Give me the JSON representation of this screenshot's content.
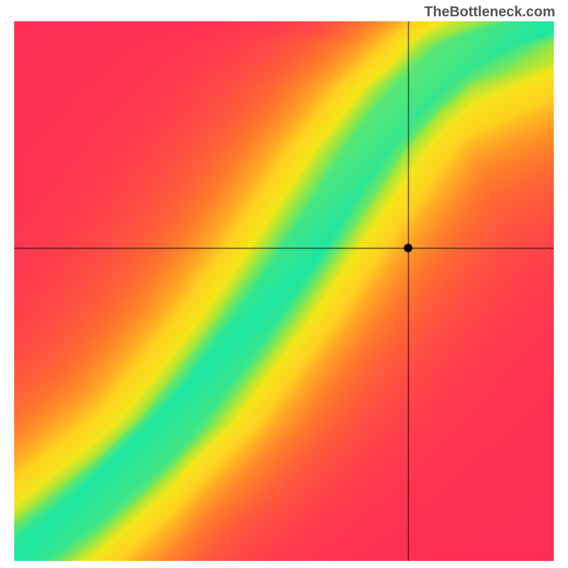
{
  "watermark": "TheBottleneck.com",
  "chart_data": {
    "type": "heatmap",
    "title": "",
    "xlabel": "",
    "ylabel": "",
    "xlim": [
      0,
      100
    ],
    "ylim": [
      0,
      100
    ],
    "crosshair": {
      "x": 73,
      "y": 58
    },
    "marker": {
      "x": 73,
      "y": 58
    },
    "ridge_path": [
      {
        "x": 0,
        "y": 0
      },
      {
        "x": 15,
        "y": 11
      },
      {
        "x": 30,
        "y": 25
      },
      {
        "x": 45,
        "y": 45
      },
      {
        "x": 55,
        "y": 60
      },
      {
        "x": 65,
        "y": 76
      },
      {
        "x": 75,
        "y": 88
      },
      {
        "x": 85,
        "y": 96
      },
      {
        "x": 100,
        "y": 100
      }
    ],
    "color_stops": [
      {
        "t": 0.0,
        "color": "#ff2d55"
      },
      {
        "t": 0.25,
        "color": "#ff7a2b"
      },
      {
        "t": 0.5,
        "color": "#ffd21f"
      },
      {
        "t": 0.7,
        "color": "#f4e61a"
      },
      {
        "t": 0.88,
        "color": "#9be641"
      },
      {
        "t": 1.0,
        "color": "#1fe6a0"
      }
    ],
    "ridge_width": 0.07
  }
}
